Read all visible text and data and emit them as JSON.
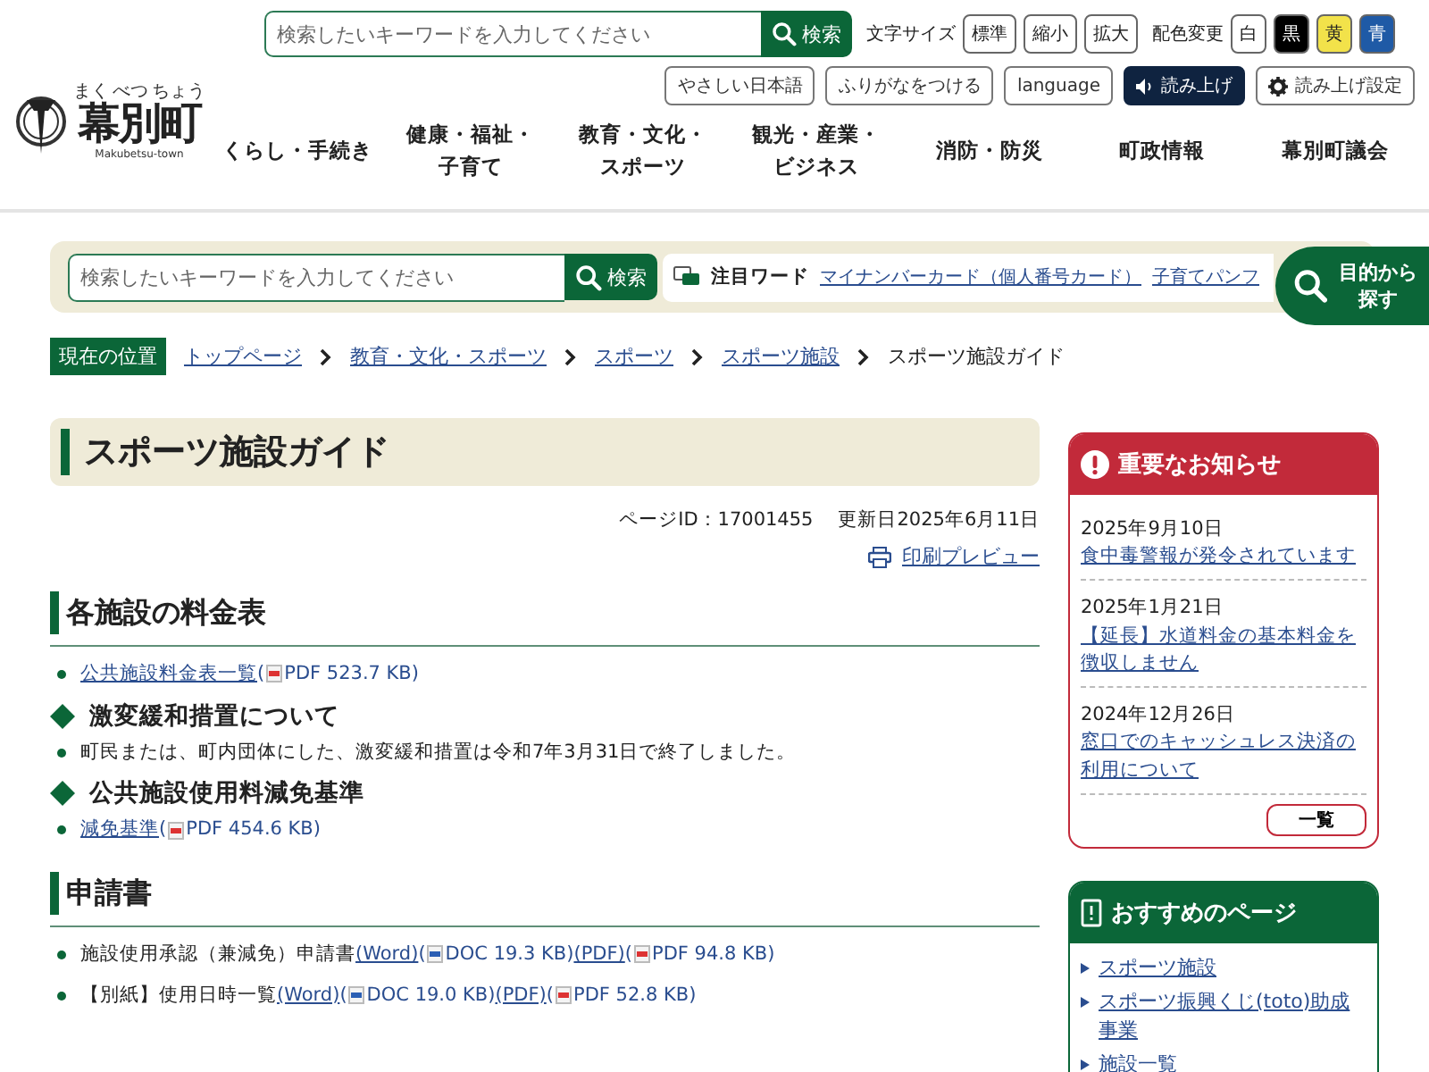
{
  "header": {
    "logo": {
      "name": "幕別町",
      "ruby": [
        "まく",
        "べつ",
        "ちょう"
      ],
      "sub": "Makubetsu-town"
    },
    "search": {
      "placeholder": "検索したいキーワードを入力してください",
      "button": "検索"
    },
    "font_size": {
      "label": "文字サイズ",
      "buttons": [
        "標準",
        "縮小",
        "拡大"
      ]
    },
    "color_scheme": {
      "label": "配色変更",
      "options": [
        {
          "label": "白",
          "color": "#ffffff"
        },
        {
          "label": "黒",
          "color": "#000000"
        },
        {
          "label": "黄",
          "color": "#f2e24a"
        },
        {
          "label": "青",
          "color": "#1f5aa6"
        }
      ]
    },
    "tools": [
      "やさしい日本語",
      "ふりがなをつける",
      "language"
    ],
    "read_aloud": "読み上げ",
    "read_settings": "読み上げ設定",
    "nav": [
      {
        "kind": "single",
        "label": "くらし・手続き"
      },
      {
        "kind": "double",
        "label": "健康・福祉・子育て"
      },
      {
        "kind": "double",
        "label": "教育・文化・スポーツ"
      },
      {
        "kind": "double",
        "label": "観光・産業・ビジネス"
      },
      {
        "kind": "single",
        "label": "消防・防災"
      },
      {
        "kind": "single",
        "label": "町政情報"
      },
      {
        "kind": "single",
        "label": "幕別町議会"
      }
    ]
  },
  "search_band": {
    "placeholder": "検索したいキーワードを入力してください",
    "button": "検索",
    "featured_label": "注目ワード",
    "featured": [
      "マイナンバーカード（個人番号カード）",
      "子育てパンフ"
    ],
    "purpose_button": "目的から探す"
  },
  "breadcrumb": {
    "label": "現在の位置",
    "items": [
      {
        "label": "トップページ",
        "link": true
      },
      {
        "label": "教育・文化・スポーツ",
        "link": true
      },
      {
        "label": "スポーツ",
        "link": true
      },
      {
        "label": "スポーツ施設",
        "link": true
      },
      {
        "label": "スポーツ施設ガイド",
        "link": false
      }
    ]
  },
  "content": {
    "title": "スポーツ施設ガイド",
    "page_id": "ページID：17001455",
    "updated": "更新日2025年6月11日",
    "print": "印刷プレビュー",
    "blocks": [
      {
        "kind": "h2",
        "text": "各施設の料金表"
      },
      {
        "kind": "item",
        "parts": [
          {
            "kind": "link",
            "text": "公共施設料金表一覧 "
          },
          {
            "kind": "meta",
            "text": "("
          },
          {
            "kind": "pdf",
            "text": "PDF 523.7 KB)"
          }
        ]
      },
      {
        "kind": "h3",
        "text": "激変緩和措置について"
      },
      {
        "kind": "item",
        "parts": [
          {
            "kind": "text",
            "text": "町民または、町内団体にした、激変緩和措置は令和7年3月31日で終了しました。"
          }
        ]
      },
      {
        "kind": "h3",
        "text": "公共施設使用料減免基準"
      },
      {
        "kind": "item",
        "parts": [
          {
            "kind": "link",
            "text": "減免基準"
          },
          {
            "kind": "meta",
            "text": "("
          },
          {
            "kind": "pdf",
            "text": "PDF 454.6 KB)"
          }
        ]
      },
      {
        "kind": "h2",
        "text": "申請書"
      },
      {
        "kind": "item",
        "parts": [
          {
            "kind": "text",
            "text": "施設使用承認（兼減免）申請書"
          },
          {
            "kind": "link",
            "text": "(Word)"
          },
          {
            "kind": "meta",
            "text": "("
          },
          {
            "kind": "doc",
            "text": "DOC 19.3 KB)"
          },
          {
            "kind": "link",
            "text": "(PDF)"
          },
          {
            "kind": "meta",
            "text": "("
          },
          {
            "kind": "pdf",
            "text": "PDF 94.8 KB)"
          }
        ]
      },
      {
        "kind": "item",
        "parts": [
          {
            "kind": "text",
            "text": "【別紙】使用日時一覧"
          },
          {
            "kind": "link",
            "text": "(Word)"
          },
          {
            "kind": "meta",
            "text": "("
          },
          {
            "kind": "doc",
            "text": "DOC 19.0 KB)"
          },
          {
            "kind": "link",
            "text": "(PDF)"
          },
          {
            "kind": "meta",
            "text": "("
          },
          {
            "kind": "pdf",
            "text": "PDF 52.8 KB)"
          }
        ]
      }
    ]
  },
  "notices": {
    "title": "重要なお知らせ",
    "items": [
      {
        "date": "2025年9月10日",
        "title": "食中毒警報が発令されています"
      },
      {
        "date": "2025年1月21日",
        "title": "【延長】水道料金の基本料金を徴収しません"
      },
      {
        "date": "2024年12月26日",
        "title": "窓口でのキャッシュレス決済の利用について"
      }
    ],
    "more": "一覧"
  },
  "recommended": {
    "title": "おすすめのページ",
    "links": [
      "スポーツ施設",
      "スポーツ振興くじ(toto)助成事業",
      "施設一覧"
    ]
  }
}
